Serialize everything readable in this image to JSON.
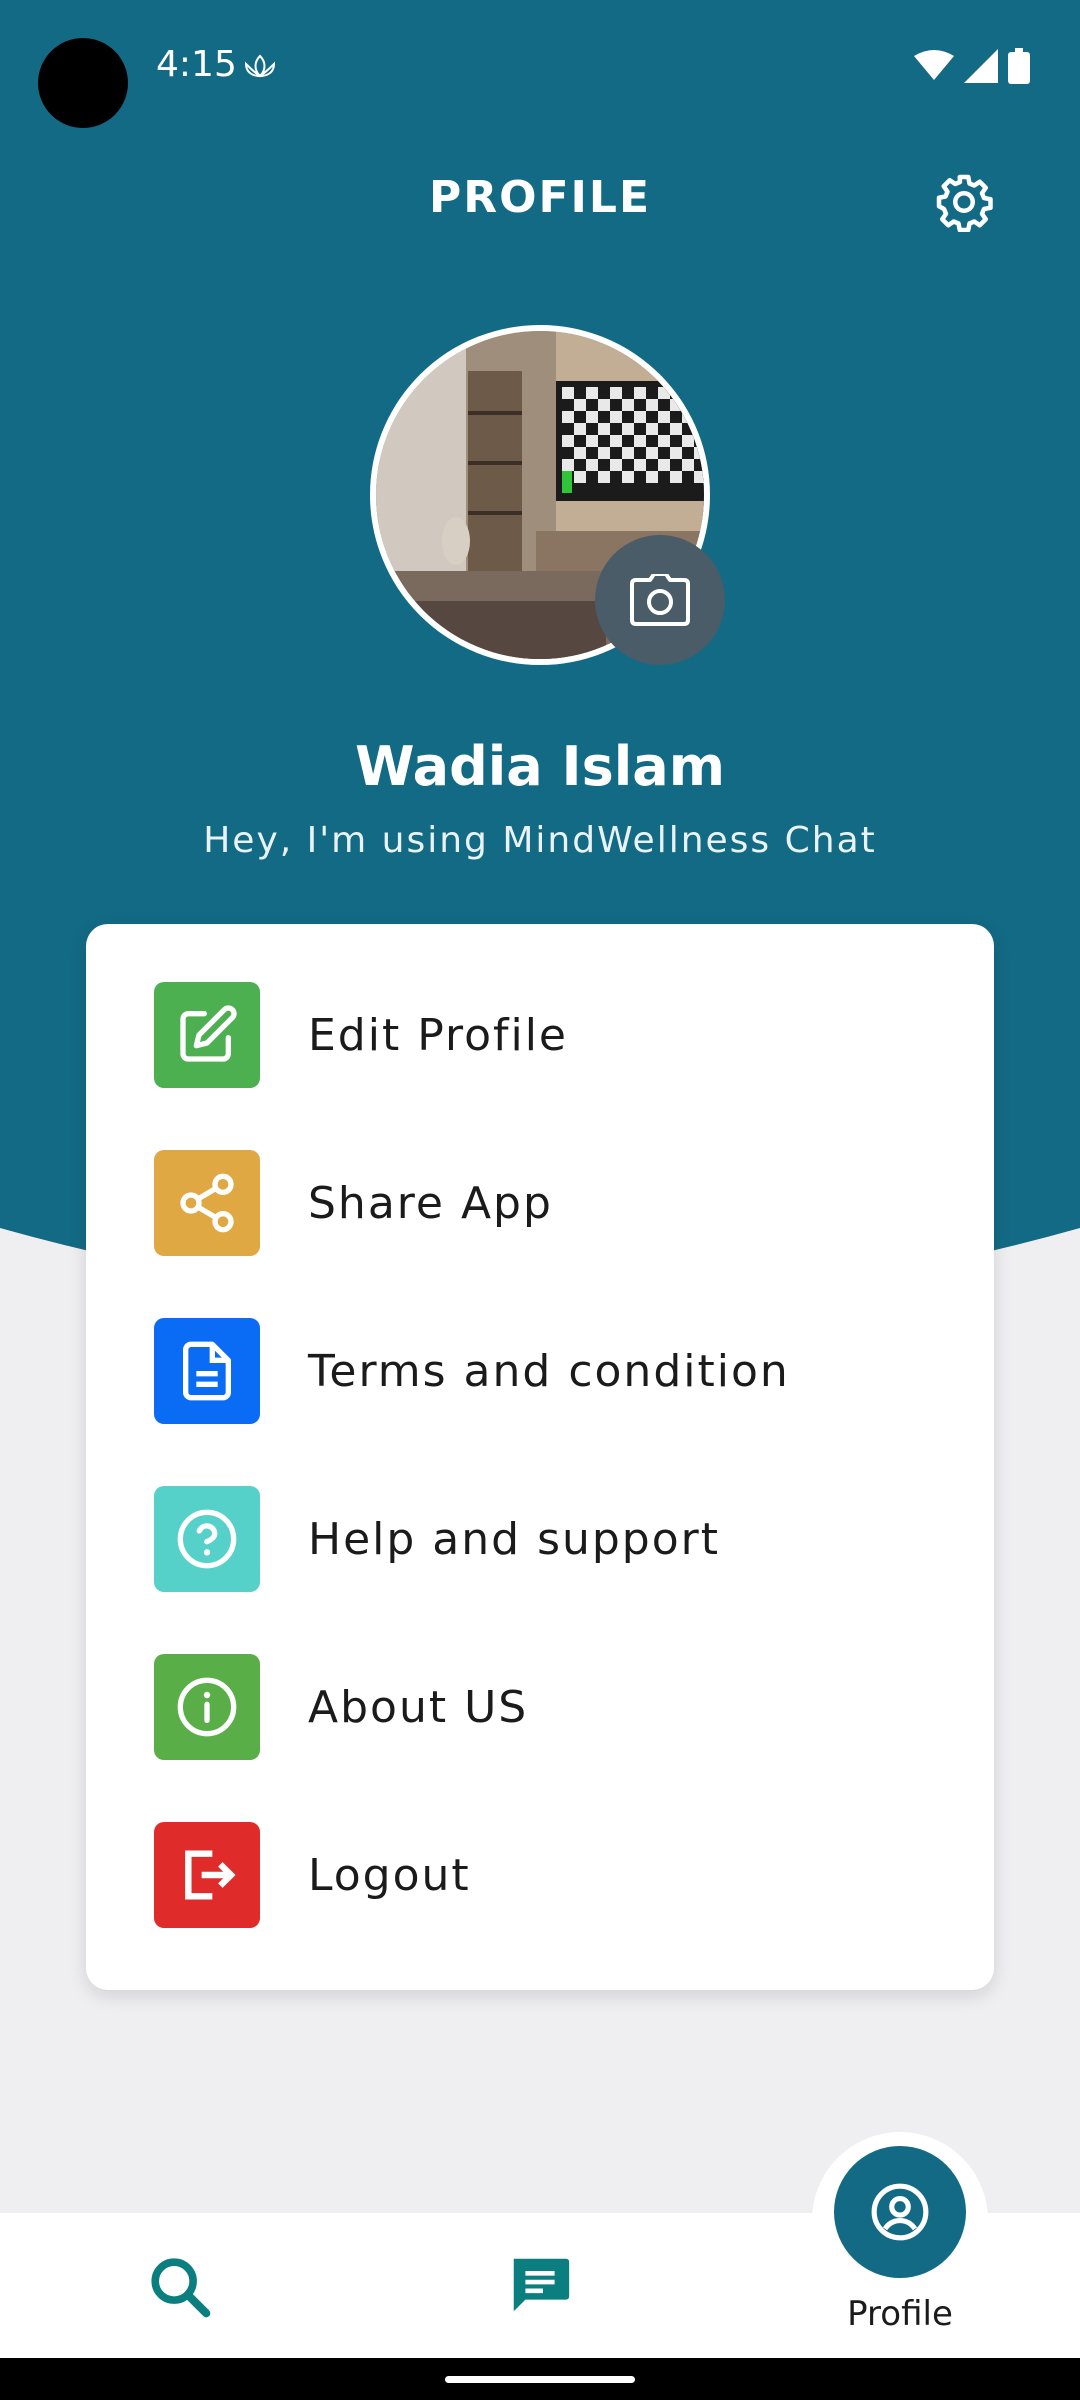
{
  "status_bar": {
    "time": "4:15"
  },
  "header": {
    "title": "PROFILE"
  },
  "profile": {
    "name": "Wadia Islam",
    "status": "Hey, I'm using MindWellness Chat"
  },
  "menu": {
    "items": [
      {
        "label": "Edit Profile",
        "icon": "edit-icon",
        "color": "#4caf50"
      },
      {
        "label": "Share App",
        "icon": "share-icon",
        "color": "#e0a843"
      },
      {
        "label": "Terms and condition",
        "icon": "document-icon",
        "color": "#0a6cf5"
      },
      {
        "label": "Help and support",
        "icon": "help-icon",
        "color": "#55d1c9"
      },
      {
        "label": "About US",
        "icon": "info-icon",
        "color": "#5aae47"
      },
      {
        "label": "Logout",
        "icon": "logout-icon",
        "color": "#e02b2b"
      }
    ]
  },
  "bottom_nav": {
    "profile_label": "Profile"
  },
  "colors": {
    "primary": "#136a85",
    "background": "#efeef1",
    "nav_icon": "#0b7f7f"
  }
}
